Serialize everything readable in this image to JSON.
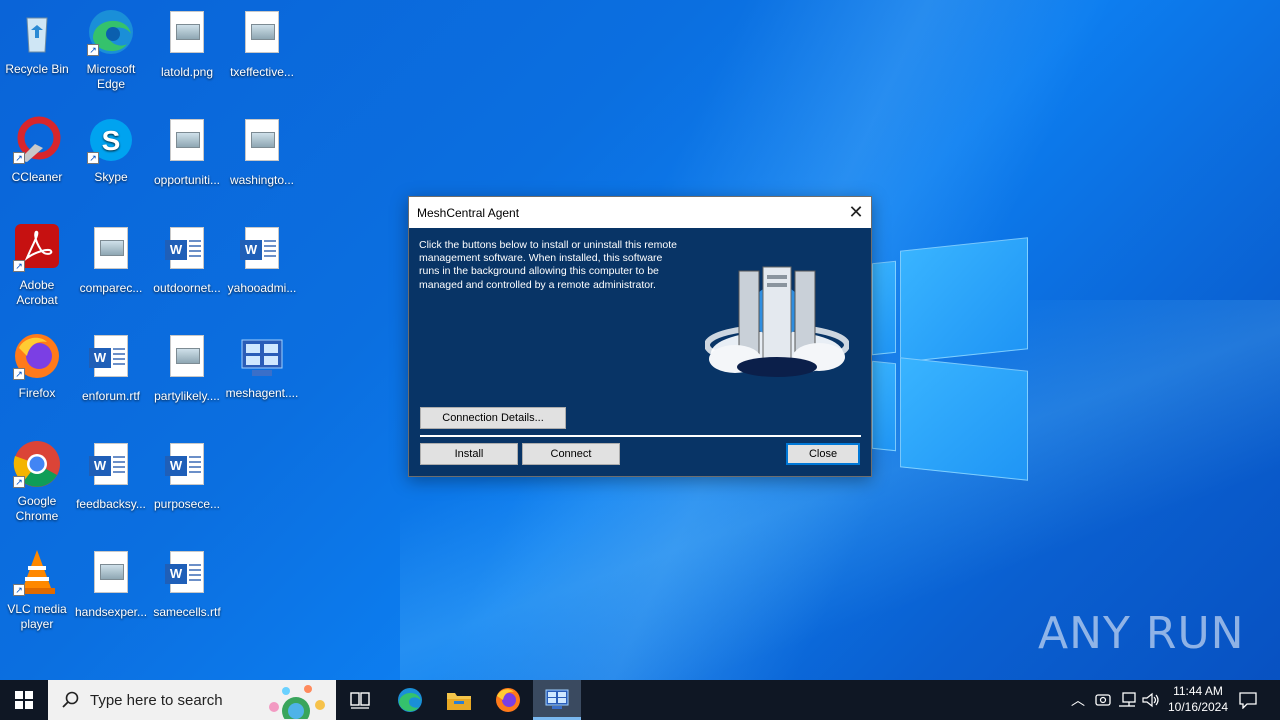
{
  "desktop": {
    "icons": [
      {
        "label": "Recycle Bin",
        "icon": "recycle-bin-icon"
      },
      {
        "label": "Microsoft Edge",
        "icon": "edge-icon"
      },
      {
        "label": "latold.png",
        "icon": "image-file-icon"
      },
      {
        "label": "txeffective...",
        "icon": "image-file-icon"
      },
      {
        "label": "CCleaner",
        "icon": "ccleaner-icon"
      },
      {
        "label": "Skype",
        "icon": "skype-icon"
      },
      {
        "label": "opportuniti...",
        "icon": "image-file-icon"
      },
      {
        "label": "washingto...",
        "icon": "image-file-icon"
      },
      {
        "label": "Adobe Acrobat",
        "icon": "acrobat-icon"
      },
      {
        "label": "comparec...",
        "icon": "image-file-icon"
      },
      {
        "label": "outdoornet...",
        "icon": "word-file-icon"
      },
      {
        "label": "yahooadmi...",
        "icon": "word-file-icon"
      },
      {
        "label": "Firefox",
        "icon": "firefox-icon"
      },
      {
        "label": "enforum.rtf",
        "icon": "word-file-icon"
      },
      {
        "label": "partylikely....",
        "icon": "image-file-icon"
      },
      {
        "label": "meshagent....",
        "icon": "meshagent-icon"
      },
      {
        "label": "Google Chrome",
        "icon": "chrome-icon"
      },
      {
        "label": "feedbacksy...",
        "icon": "word-file-icon"
      },
      {
        "label": "purposece...",
        "icon": "word-file-icon"
      },
      {
        "label": "VLC media player",
        "icon": "vlc-icon"
      },
      {
        "label": "handsexper...",
        "icon": "image-file-icon"
      },
      {
        "label": "samecells.rtf",
        "icon": "word-file-icon"
      }
    ]
  },
  "dialog": {
    "title": "MeshCentral Agent",
    "description": "Click the buttons below to install or uninstall this remote management software. When installed, this software runs in the background allowing this computer to be managed and controlled by a remote administrator.",
    "connection_details_label": "Connection Details...",
    "install_label": "Install",
    "connect_label": "Connect",
    "close_label": "Close"
  },
  "taskbar": {
    "search_placeholder": "Type here to search",
    "time": "11:44 AM",
    "date": "10/16/2024"
  },
  "watermark": "ANY RUN",
  "colors": {
    "desktop_blue": "#0b6fe0",
    "dialog_bg": "#083466",
    "taskbar_bg": "#0f1724",
    "default_button_border": "#0078d7"
  }
}
